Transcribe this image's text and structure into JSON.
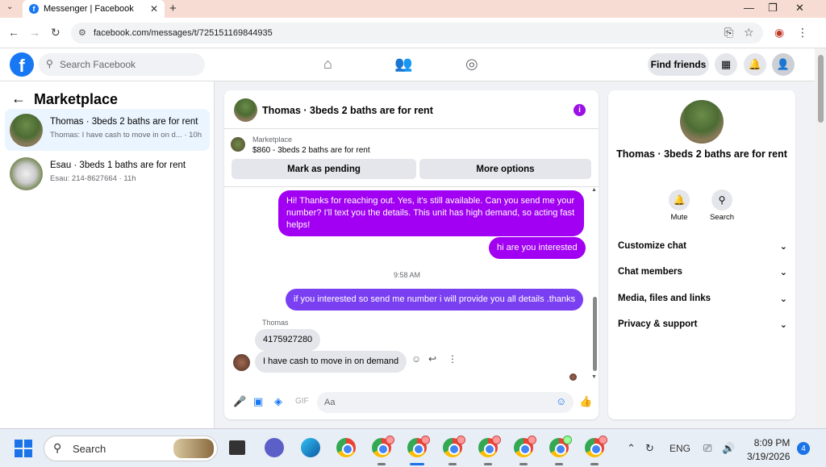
{
  "browser": {
    "tab_title": "Messenger | Facebook",
    "url": "facebook.com/messages/t/725151169844935"
  },
  "fb_header": {
    "search_placeholder": "Search Facebook",
    "find_friends_label": "Find friends"
  },
  "left_panel": {
    "title": "Marketplace",
    "conversations": [
      {
        "title": "Thomas · 3beds 2 baths are for rent",
        "preview": "Thomas: I have cash to move in on d... · 10h",
        "active": true
      },
      {
        "title": "Esau · 3beds 1 baths are for rent",
        "preview": "Esau: 214-8627664 · 11h",
        "active": false
      }
    ]
  },
  "chat": {
    "header_title": "Thomas · 3beds 2 baths are for rent",
    "listing_source": "Marketplace",
    "listing_detail": "$860 - 3beds 2 baths are for rent",
    "mark_pending_label": "Mark as pending",
    "more_options_label": "More options",
    "messages": [
      {
        "from": "me",
        "text": "Hi! Thanks for reaching out. Yes, it's still available. Can you send me your number? I'll text you the details. This unit has high demand, so acting fast helps!"
      },
      {
        "from": "me",
        "text": "hi are you interested"
      },
      {
        "from": "me",
        "text": "if you interested so send me number i will provide you all details .thanks"
      },
      {
        "from": "them",
        "text": "4175927280"
      },
      {
        "from": "them",
        "text": "I have cash to move in on demand"
      }
    ],
    "timestamp": "9:58 AM",
    "sender_name": "Thomas",
    "input_placeholder": "Aa"
  },
  "right_panel": {
    "name": "Thomas · 3beds 2 baths are for rent",
    "actions": [
      {
        "label": "Mute",
        "icon": "bell-icon"
      },
      {
        "label": "Search",
        "icon": "search-icon"
      }
    ],
    "sections": [
      "Customize chat",
      "Chat members",
      "Media, files and links",
      "Privacy & support"
    ]
  },
  "taskbar": {
    "search_label": "Search",
    "language": "ENG",
    "time": "8:09 PM",
    "date": "3/19/2026",
    "notification_count": "4"
  },
  "colors": {
    "fb_blue": "#1877f2",
    "my_bubble": "#a100f2",
    "my_bubble_alt": "#7b3ff2",
    "their_bubble": "#e4e6eb"
  }
}
